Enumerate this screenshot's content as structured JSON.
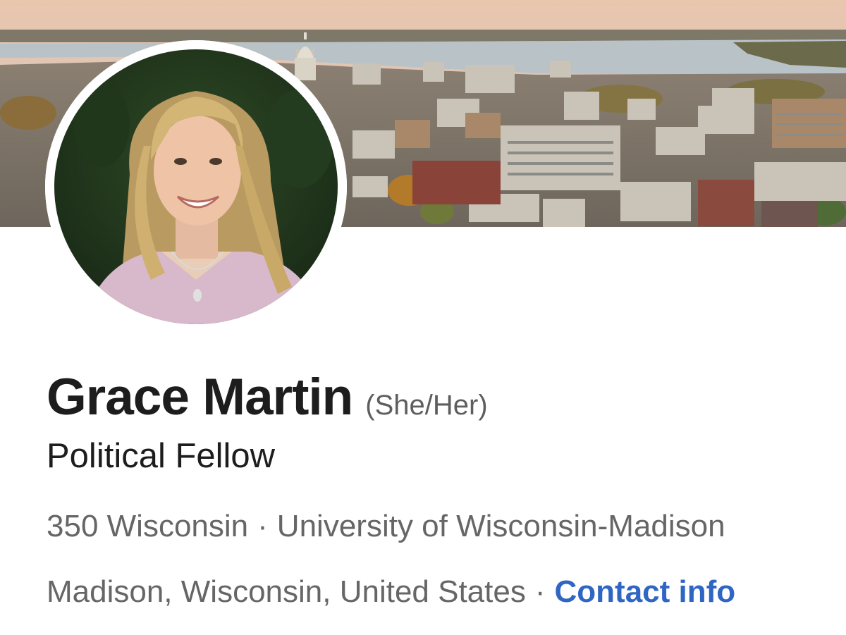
{
  "profile": {
    "name": "Grace Martin",
    "pronouns": "(She/Her)",
    "headline": "Political Fellow",
    "organization": "350 Wisconsin",
    "school": "University of Wisconsin-Madison",
    "location": "Madison, Wisconsin, United States",
    "contact_label": "Contact info",
    "separator": "·"
  },
  "colors": {
    "link": "#2f66c4",
    "name_text": "#1d1d1d",
    "secondary_text": "#666666"
  }
}
